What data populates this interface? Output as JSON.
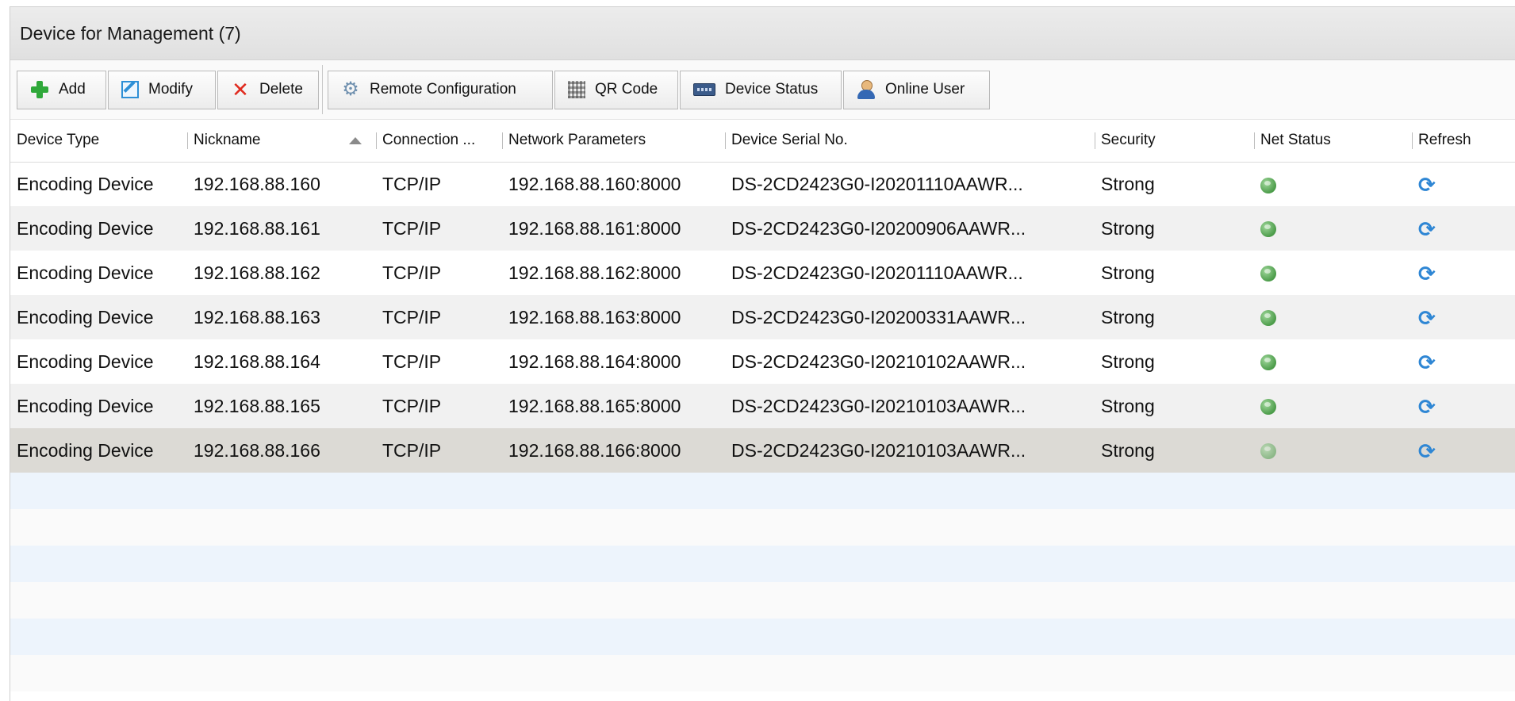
{
  "panel": {
    "title": "Device for Management (7)"
  },
  "toolbar": {
    "add_label": "Add",
    "modify_label": "Modify",
    "delete_label": "Delete",
    "remote_config_label": "Remote Configuration",
    "qr_code_label": "QR Code",
    "device_status_label": "Device Status",
    "online_user_label": "Online User"
  },
  "table": {
    "columns": [
      "Device Type",
      "Nickname",
      "Connection ...",
      "Network Parameters",
      "Device Serial No.",
      "Security",
      "Net Status",
      "Refresh"
    ],
    "sorted_column": "Nickname",
    "sort_direction": "ascending",
    "rows": [
      {
        "device_type": "Encoding Device",
        "nickname": "192.168.88.160",
        "connection": "TCP/IP",
        "network": "192.168.88.160:8000",
        "serial": "DS-2CD2423G0-I20201110AAWR...",
        "security": "Strong"
      },
      {
        "device_type": "Encoding Device",
        "nickname": "192.168.88.161",
        "connection": "TCP/IP",
        "network": "192.168.88.161:8000",
        "serial": "DS-2CD2423G0-I20200906AAWR...",
        "security": "Strong"
      },
      {
        "device_type": "Encoding Device",
        "nickname": "192.168.88.162",
        "connection": "TCP/IP",
        "network": "192.168.88.162:8000",
        "serial": "DS-2CD2423G0-I20201110AAWR...",
        "security": "Strong"
      },
      {
        "device_type": "Encoding Device",
        "nickname": "192.168.88.163",
        "connection": "TCP/IP",
        "network": "192.168.88.163:8000",
        "serial": "DS-2CD2423G0-I20200331AAWR...",
        "security": "Strong"
      },
      {
        "device_type": "Encoding Device",
        "nickname": "192.168.88.164",
        "connection": "TCP/IP",
        "network": "192.168.88.164:8000",
        "serial": "DS-2CD2423G0-I20210102AAWR...",
        "security": "Strong"
      },
      {
        "device_type": "Encoding Device",
        "nickname": "192.168.88.165",
        "connection": "TCP/IP",
        "network": "192.168.88.165:8000",
        "serial": "DS-2CD2423G0-I20210103AAWR...",
        "security": "Strong"
      },
      {
        "device_type": "Encoding Device",
        "nickname": "192.168.88.166",
        "connection": "TCP/IP",
        "network": "192.168.88.166:8000",
        "serial": "DS-2CD2423G0-I20210103AAWR...",
        "security": "Strong"
      }
    ],
    "selected_row": 6,
    "icons": {
      "net_status": "globe-icon",
      "refresh": "refresh-icon"
    },
    "colors": {
      "net_status_online": "#4c9c4a",
      "refresh_blue": "#2e86d4",
      "selected_row_bg": "#dcdad5"
    }
  }
}
